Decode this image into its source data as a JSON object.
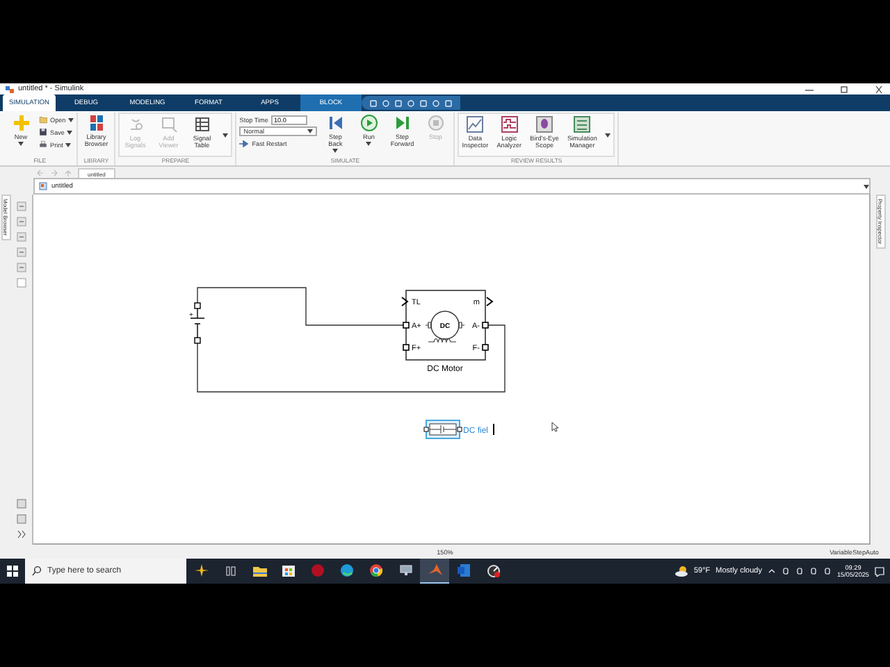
{
  "window": {
    "title": "untitled * - Simulink"
  },
  "tabs": [
    {
      "label": "SIMULATION",
      "selected": true,
      "contextual": false
    },
    {
      "label": "DEBUG",
      "selected": false,
      "contextual": false
    },
    {
      "label": "MODELING",
      "selected": false,
      "contextual": false
    },
    {
      "label": "FORMAT",
      "selected": false,
      "contextual": false
    },
    {
      "label": "APPS",
      "selected": false,
      "contextual": false
    },
    {
      "label": "BLOCK",
      "selected": false,
      "contextual": true
    }
  ],
  "ribbon": {
    "groups": [
      {
        "label": "FILE",
        "expandable": false,
        "items": [
          {
            "kind": "large",
            "label": "New",
            "dropdown": true,
            "disabled": false
          },
          {
            "kind": "small",
            "label": "Open",
            "dropdown": true,
            "disabled": false
          },
          {
            "kind": "small",
            "label": "Save",
            "dropdown": true,
            "disabled": false
          },
          {
            "kind": "small",
            "label": "Print",
            "dropdown": true,
            "disabled": false
          }
        ]
      },
      {
        "label": "LIBRARY",
        "expandable": false,
        "items": [
          {
            "kind": "large",
            "label": "Library Browser",
            "dropdown": false,
            "disabled": false
          }
        ]
      },
      {
        "label": "PREPARE",
        "expandable": true,
        "items": [
          {
            "kind": "large",
            "label": "Log Signals",
            "dropdown": false,
            "disabled": true
          },
          {
            "kind": "large",
            "label": "Add Viewer",
            "dropdown": false,
            "disabled": true
          },
          {
            "kind": "large",
            "label": "Signal Table",
            "dropdown": false,
            "disabled": false
          }
        ]
      },
      {
        "label": "SIMULATE",
        "expandable": false,
        "items": [
          {
            "kind": "field",
            "label": "Stop Time",
            "value": "10.0"
          },
          {
            "kind": "select",
            "value": "Normal"
          },
          {
            "kind": "toggle",
            "label": "Fast Restart"
          },
          {
            "kind": "large",
            "label": "Step Back",
            "dropdown": true,
            "disabled": false
          },
          {
            "kind": "large",
            "label": "Run",
            "dropdown": true,
            "disabled": false
          },
          {
            "kind": "large",
            "label": "Step Forward",
            "dropdown": false,
            "disabled": false
          },
          {
            "kind": "large",
            "label": "Stop",
            "dropdown": false,
            "disabled": true
          }
        ]
      },
      {
        "label": "REVIEW RESULTS",
        "expandable": true,
        "items": [
          {
            "kind": "large",
            "label": "Data Inspector",
            "dropdown": false,
            "disabled": false
          },
          {
            "kind": "large",
            "label": "Logic Analyzer",
            "dropdown": false,
            "disabled": false
          },
          {
            "kind": "large",
            "label": "Bird's-Eye Scope",
            "dropdown": false,
            "disabled": false
          },
          {
            "kind": "large",
            "label": "Simulation Manager",
            "dropdown": false,
            "disabled": false
          }
        ]
      }
    ]
  },
  "editor": {
    "history_tab": "untitled",
    "breadcrumb": "untitled"
  },
  "side_panels": {
    "left": "Model Browser",
    "right": "Property Inspector"
  },
  "diagram": {
    "source_label": "+",
    "motor": {
      "symbol": "DC",
      "name": "DC Motor",
      "left_ports": [
        {
          "label": "TL",
          "kind": "signal"
        },
        {
          "label": "A+",
          "kind": "conserving"
        },
        {
          "label": "F+",
          "kind": "conserving"
        }
      ],
      "right_ports": [
        {
          "label": "m",
          "kind": "signal"
        },
        {
          "label": "A-",
          "kind": "conserving"
        },
        {
          "label": "F-",
          "kind": "conserving"
        }
      ]
    },
    "new_block": {
      "selected": true,
      "name": "DC fiel",
      "editing": true
    }
  },
  "status_bar": {
    "zoom": "150%",
    "solver": "VariableStepAuto"
  },
  "taskbar": {
    "search": {
      "placeholder": "Type here to search"
    },
    "apps": [
      {
        "kind": "explorer",
        "active": false
      },
      {
        "kind": "store",
        "active": false
      },
      {
        "kind": "record",
        "active": false
      },
      {
        "kind": "edge",
        "active": false
      },
      {
        "kind": "chrome",
        "active": false
      },
      {
        "kind": "remote",
        "active": false
      },
      {
        "kind": "matlab",
        "active": true
      },
      {
        "kind": "word",
        "active": false
      },
      {
        "kind": "gauge",
        "active": false
      }
    ],
    "weather": {
      "temperature": "59°F",
      "condition": "Mostly cloudy"
    },
    "clock": {
      "time": "09:29",
      "date": "15/05/2025"
    }
  }
}
